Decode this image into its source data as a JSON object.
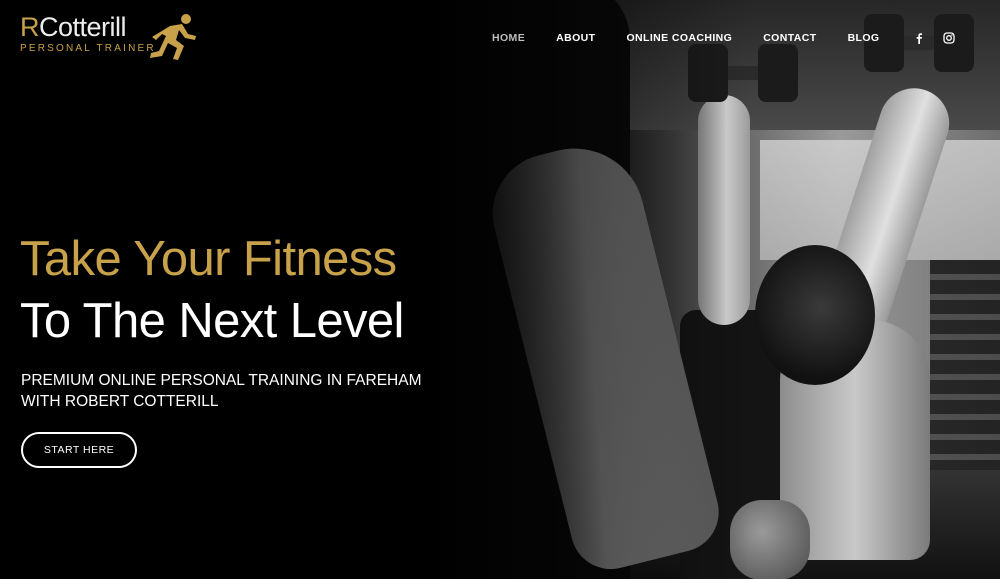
{
  "brand": {
    "logo_initial": "R",
    "logo_rest": "Cotterill",
    "tagline": "PERSONAL TRAINER",
    "accent_color": "#c8a24a",
    "logo_icon": "runner-icon"
  },
  "nav": {
    "items": [
      {
        "label": "HOME",
        "active": true
      },
      {
        "label": "ABOUT",
        "active": false
      },
      {
        "label": "ONLINE COACHING",
        "active": false
      },
      {
        "label": "CONTACT",
        "active": false
      },
      {
        "label": "BLOG",
        "active": false
      }
    ],
    "social_icons": [
      "facebook-icon",
      "instagram-icon"
    ]
  },
  "hero": {
    "headline_line1": "Take Your Fitness",
    "headline_line2": "To The Next Level",
    "subheading": "PREMIUM ONLINE PERSONAL TRAINING IN FAREHAM WITH ROBERT COTTERILL",
    "cta_label": "START HERE"
  }
}
